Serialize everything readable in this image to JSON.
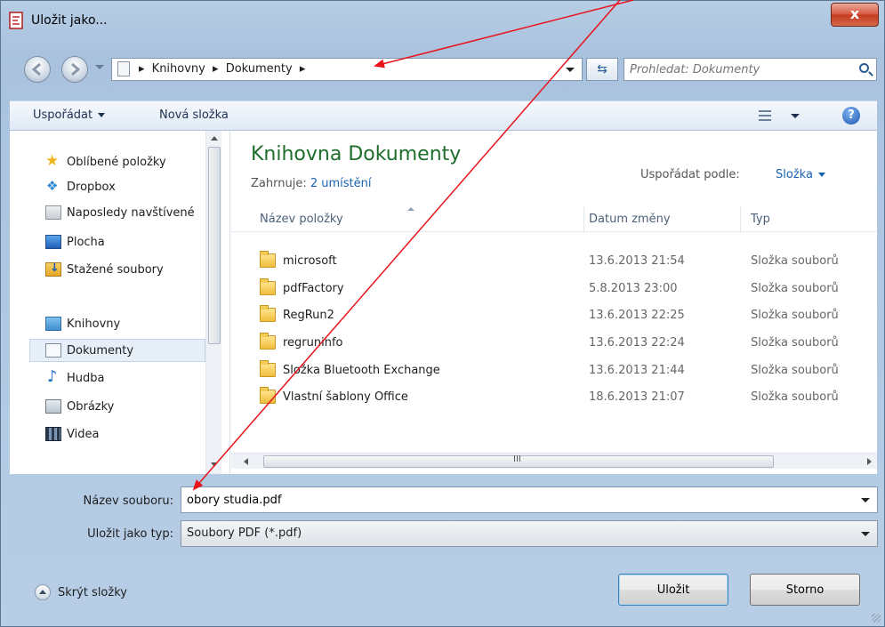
{
  "window": {
    "title": "Uložit jako..."
  },
  "address": {
    "path": [
      "Knihovny",
      "Dokumenty"
    ],
    "search_placeholder": "Prohledat: Dokumenty"
  },
  "toolbar": {
    "organize": "Uspořádat",
    "new_folder": "Nová složka"
  },
  "nav": {
    "favorites": "Oblíbené položky",
    "dropbox": "Dropbox",
    "recent": "Naposledy navštívené",
    "desktop": "Plocha",
    "downloads": "Stažené soubory",
    "libraries": "Knihovny",
    "documents": "Dokumenty",
    "music": "Hudba",
    "pictures": "Obrázky",
    "videos": "Videa"
  },
  "library": {
    "title": "Knihovna Dokumenty",
    "includes_label": "Zahrnuje:",
    "includes_link": "2 umístění",
    "arrange_label": "Uspořádat podle:",
    "arrange_value": "Složka"
  },
  "columns": {
    "name": "Název položky",
    "date": "Datum změny",
    "type": "Typ"
  },
  "files": [
    {
      "name": "microsoft",
      "date": "13.6.2013 21:54",
      "type": "Složka souborů"
    },
    {
      "name": "pdfFactory",
      "date": "5.8.2013 23:00",
      "type": "Složka souborů"
    },
    {
      "name": "RegRun2",
      "date": "13.6.2013 22:25",
      "type": "Složka souborů"
    },
    {
      "name": "regruninfo",
      "date": "13.6.2013 22:24",
      "type": "Složka souborů"
    },
    {
      "name": "Složka Bluetooth Exchange",
      "date": "13.6.2013 21:44",
      "type": "Složka souborů"
    },
    {
      "name": "Vlastní šablony Office",
      "date": "18.6.2013 21:07",
      "type": "Složka souborů"
    }
  ],
  "form": {
    "filename_label": "Název souboru:",
    "filename_value": "obory studia.pdf",
    "type_label": "Uložit jako typ:",
    "type_value": "Soubory PDF (*.pdf)"
  },
  "footer": {
    "hide_folders": "Skrýt složky",
    "save": "Uložit",
    "cancel": "Storno",
    "close": "x",
    "help": "?",
    "scroll_grip": "III"
  },
  "colors": {
    "annotation_arrow": "#e8141c",
    "library_title": "#1e6d2d",
    "link": "#1a61b4"
  }
}
